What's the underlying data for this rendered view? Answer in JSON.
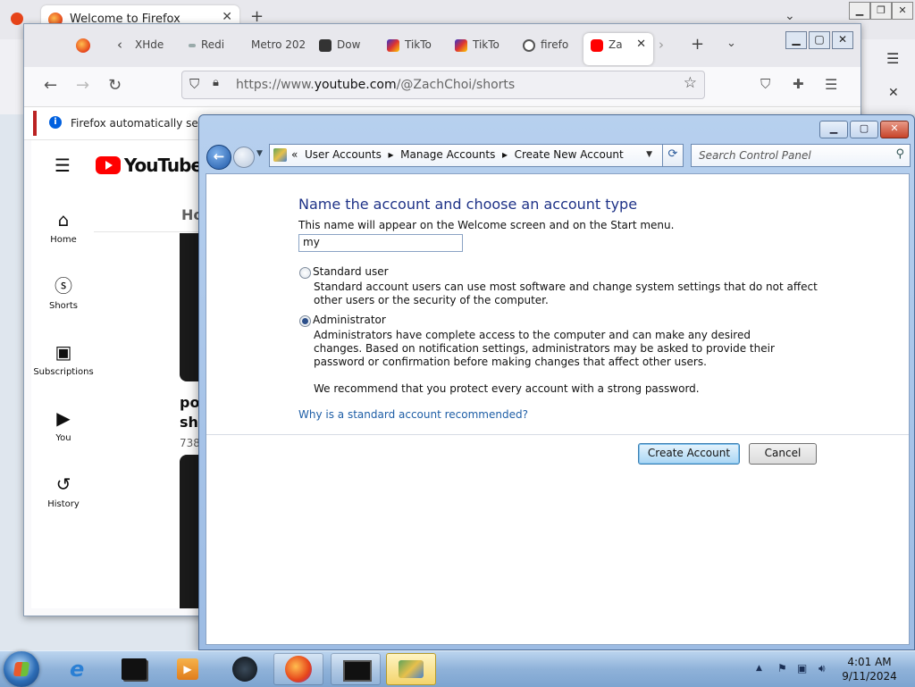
{
  "firefox_back": {
    "tab_title": "Welcome to Firefox"
  },
  "firefox_front": {
    "tabs": [
      "XHde",
      "Redi",
      "Metro 202",
      "Dow",
      "TikTo",
      "TikTo",
      "firefo",
      "Za"
    ],
    "url_prefix": "https://www.",
    "url_domain": "youtube.com",
    "url_path": "/@ZachChoi/shorts",
    "notice_text": "Firefox automatically sends"
  },
  "youtube": {
    "logo_text": "YouTube",
    "nav": [
      {
        "label": "Home",
        "icon": "home-icon"
      },
      {
        "label": "Shorts",
        "icon": "shorts-icon"
      },
      {
        "label": "Subscriptions",
        "icon": "subscriptions-icon"
      },
      {
        "label": "You",
        "icon": "you-icon"
      },
      {
        "label": "History",
        "icon": "history-icon"
      }
    ],
    "tab_partial": "Ho",
    "card_title_line1": "pop",
    "card_title_line2": "shr",
    "card_views": "738"
  },
  "control_panel": {
    "breadcrumb": [
      "User Accounts",
      "Manage Accounts",
      "Create New Account"
    ],
    "search_placeholder": "Search Control Panel",
    "heading": "Name the account and choose an account type",
    "subtitle": "This name will appear on the Welcome screen and on the Start menu.",
    "name_value": "my",
    "options": [
      {
        "label": "Standard user",
        "description": "Standard account users can use most software and change system settings that do not affect other users or the security of the computer.",
        "selected": false
      },
      {
        "label": "Administrator",
        "description": "Administrators have complete access to the computer and can make any desired changes. Based on notification settings, administrators may be asked to provide their password or confirmation before making changes that affect other users.",
        "selected": true
      }
    ],
    "recommendation": "We recommend that you protect every account with a strong password.",
    "help_link": "Why is a standard account recommended?",
    "create_button": "Create Account",
    "cancel_button": "Cancel"
  },
  "taskbar": {
    "time": "4:01 AM",
    "date": "9/11/2024"
  }
}
